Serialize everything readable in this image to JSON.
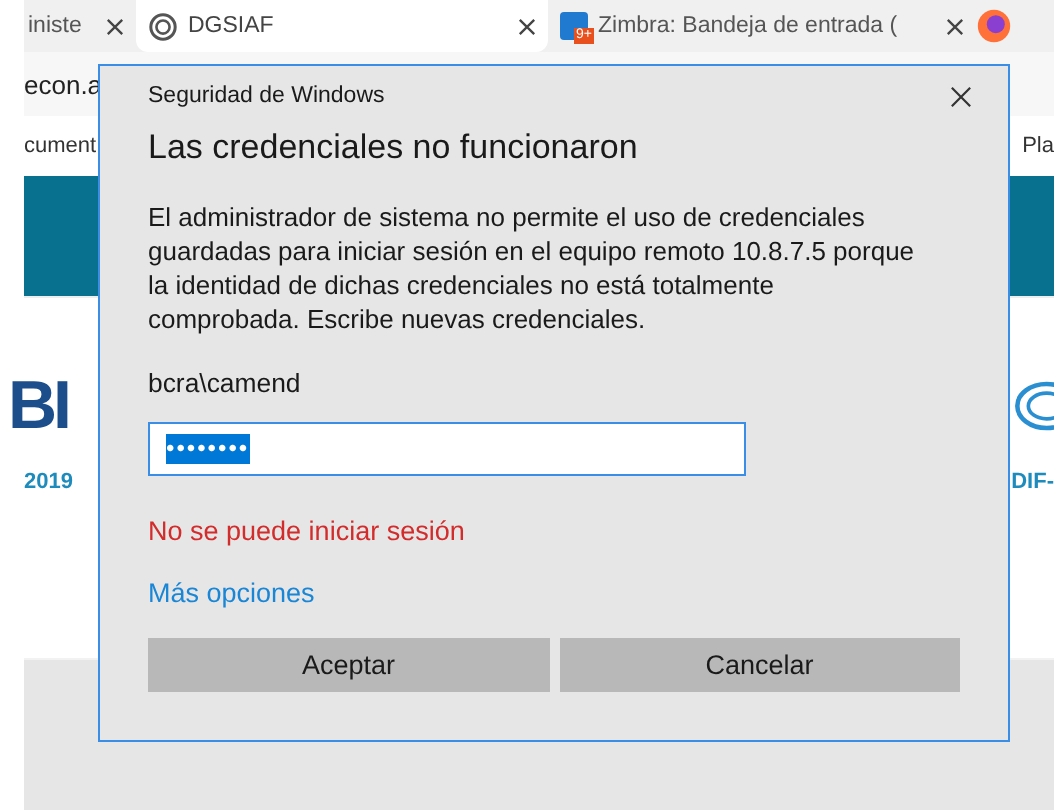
{
  "browser": {
    "tabs": [
      {
        "title": "iniste",
        "selected": false
      },
      {
        "title": "DGSIAF",
        "selected": true
      },
      {
        "title": "Zimbra: Bandeja de entrada (",
        "badge": "9+",
        "selected": false
      }
    ],
    "address": "econ.a",
    "bookmarks": [
      "cument",
      "Pla"
    ]
  },
  "page": {
    "logo_text": "BI",
    "left_caption": "2019",
    "right_caption": "DIF-"
  },
  "dialog": {
    "title": "Seguridad de Windows",
    "heading": "Las credenciales no funcionaron",
    "message": "El administrador de sistema no permite el uso de credenciales guardadas para iniciar sesión en el equipo remoto 10.8.7.5 porque la identidad de dichas credenciales no está totalmente comprobada. Escribe nuevas credenciales.",
    "username": "bcra\\camend",
    "password": {
      "value": "••••••••",
      "selected": true
    },
    "error": "No se puede iniciar sesión",
    "link": "Más opciones",
    "buttons": [
      "Aceptar",
      "Cancelar"
    ]
  }
}
